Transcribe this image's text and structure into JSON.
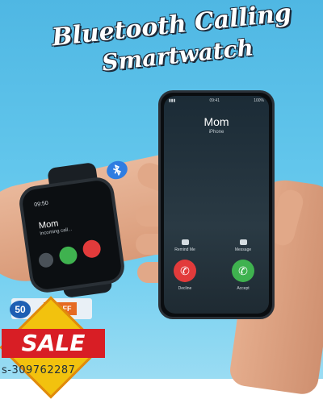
{
  "headline": {
    "line1": "Bluetooth Calling",
    "line2": "Smartwatch"
  },
  "watch": {
    "time": "09:50",
    "caller_name": "Mom",
    "caller_status": "Incoming call...",
    "colors": {
      "decline": "#e23b3b",
      "accept": "#3fb24f",
      "mute": "#4a5158"
    }
  },
  "phone": {
    "status_time": "09:41",
    "status_battery": "100%",
    "caller_name": "Mom",
    "caller_sub": "iPhone",
    "option_left": "Remind Me",
    "option_right": "Message",
    "decline_label": "Decline",
    "accept_label": "Accept",
    "colors": {
      "decline": "#e23b3b",
      "accept": "#3fb24f"
    }
  },
  "bluetooth_icon": "bluetooth-icon",
  "promo": {
    "percent": "50",
    "off_label": "% OFF",
    "sale_label": "SALE"
  },
  "sku": "s-309762287"
}
